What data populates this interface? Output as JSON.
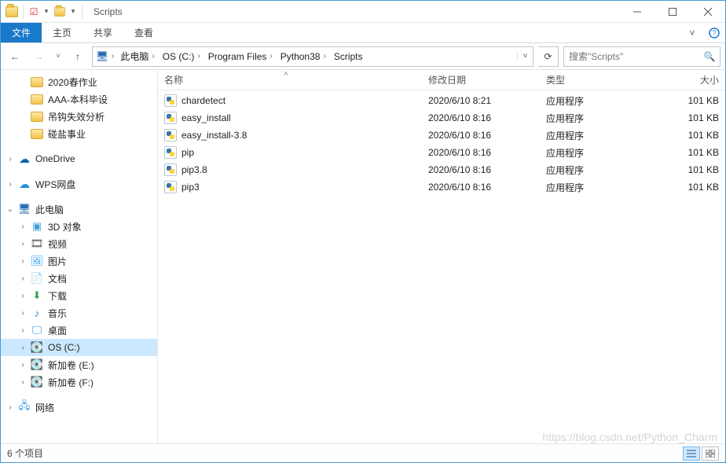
{
  "window": {
    "title": "Scripts"
  },
  "ribbon": {
    "file": "文件",
    "tabs": [
      "主页",
      "共享",
      "查看"
    ]
  },
  "breadcrumb": {
    "segments": [
      "此电脑",
      "OS (C:)",
      "Program Files",
      "Python38",
      "Scripts"
    ]
  },
  "search": {
    "placeholder": "搜索\"Scripts\""
  },
  "columns": {
    "name": "名称",
    "date": "修改日期",
    "type": "类型",
    "size": "大小"
  },
  "sidebar": {
    "quick": [
      {
        "label": "2020春作业",
        "icon": "folder"
      },
      {
        "label": "AAA-本科毕设",
        "icon": "folder"
      },
      {
        "label": "吊钩失效分析",
        "icon": "folder"
      },
      {
        "label": "碰盐事业",
        "icon": "folder"
      }
    ],
    "clouds": [
      {
        "label": "OneDrive",
        "icon": "cloud",
        "color": "#0a64a4"
      },
      {
        "label": "WPS网盘",
        "icon": "cloud",
        "color": "#1d8fe0"
      }
    ],
    "pc_label": "此电脑",
    "pc_children": [
      {
        "label": "3D 对象",
        "icon": "3d"
      },
      {
        "label": "视频",
        "icon": "vid"
      },
      {
        "label": "图片",
        "icon": "pic"
      },
      {
        "label": "文档",
        "icon": "doc"
      },
      {
        "label": "下载",
        "icon": "down"
      },
      {
        "label": "音乐",
        "icon": "music"
      },
      {
        "label": "桌面",
        "icon": "desk"
      },
      {
        "label": "OS (C:)",
        "icon": "drive",
        "selected": true
      },
      {
        "label": "新加卷 (E:)",
        "icon": "drive"
      },
      {
        "label": "新加卷 (F:)",
        "icon": "drive"
      }
    ],
    "network_label": "网络"
  },
  "files": [
    {
      "name": "chardetect",
      "date": "2020/6/10 8:21",
      "type": "应用程序",
      "size": "101 KB"
    },
    {
      "name": "easy_install",
      "date": "2020/6/10 8:16",
      "type": "应用程序",
      "size": "101 KB"
    },
    {
      "name": "easy_install-3.8",
      "date": "2020/6/10 8:16",
      "type": "应用程序",
      "size": "101 KB"
    },
    {
      "name": "pip",
      "date": "2020/6/10 8:16",
      "type": "应用程序",
      "size": "101 KB"
    },
    {
      "name": "pip3.8",
      "date": "2020/6/10 8:16",
      "type": "应用程序",
      "size": "101 KB"
    },
    {
      "name": "pip3",
      "date": "2020/6/10 8:16",
      "type": "应用程序",
      "size": "101 KB"
    }
  ],
  "status": {
    "count": "6 个项目"
  },
  "watermark": "https://blog.csdn.net/Python_Charm"
}
